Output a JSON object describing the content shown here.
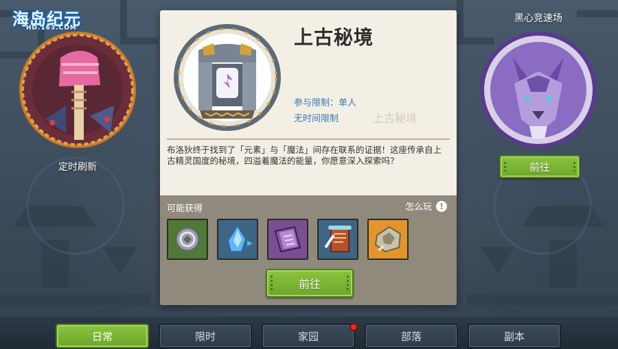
{
  "logo": {
    "title": "海岛纪元",
    "subtitle": "HD.163.COM"
  },
  "left_card": {
    "label": "定时刷新",
    "icon": "pink-totem-icon"
  },
  "right_card": {
    "title": "黑心竞速场",
    "icon": "purple-beast-icon",
    "go_label": "前往"
  },
  "panel": {
    "title": "上古秘境",
    "icon": "ancient-gate-icon",
    "limit_text": "参与限制：单人",
    "time_text": "无时间限制",
    "watermark": "上古秘境",
    "description": "布洛狄终于找到了「元素」与「魔法」间存在联系的证据！这座传承自上古精灵国度的秘境，四溢着魔法的能量，你愿意深入探索吗？",
    "rewards_title": "可能获得",
    "howto_label": "怎么玩",
    "howto_icon": "exclamation-icon",
    "rewards": [
      {
        "icon": "silver-coin-icon",
        "bg": "#4e7a35"
      },
      {
        "icon": "blue-crystal-icon",
        "bg": "#3d6685"
      },
      {
        "icon": "purple-spellbook-icon",
        "bg": "#7a4e92"
      },
      {
        "icon": "red-scroll-icon",
        "bg": "#3d6685"
      },
      {
        "icon": "stone-fragment-icon",
        "bg": "#e3952b"
      }
    ],
    "go_label": "前往"
  },
  "tabs": [
    {
      "label": "日常",
      "active": true
    },
    {
      "label": "限时",
      "active": false
    },
    {
      "label": "家园",
      "active": false,
      "badge": true
    },
    {
      "label": "部落",
      "active": false
    },
    {
      "label": "副本",
      "active": false
    }
  ],
  "colors": {
    "accent_green": "#7bb536",
    "link_blue": "#3a78b5",
    "panel_bg": "#f3efe4",
    "badge_red": "#e02b2b"
  }
}
